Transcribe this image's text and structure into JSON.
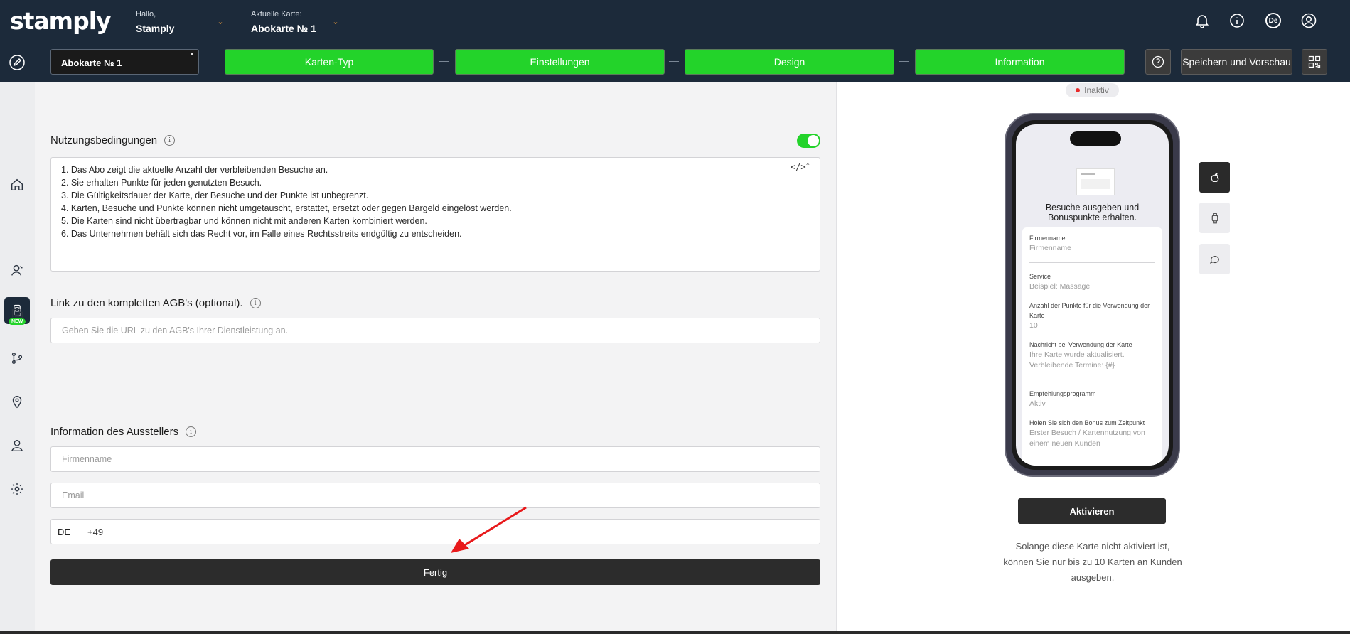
{
  "header": {
    "logo": "stamply",
    "greeting_label": "Hallo,",
    "user_name": "Stamply",
    "current_card_label": "Aktuelle Karte:",
    "current_card_name": "Abokarte № 1",
    "language": "De"
  },
  "toolbar": {
    "card_name": "Abokarte № 1",
    "required_mark": "*",
    "steps": [
      "Karten-Typ",
      "Einstellungen",
      "Design",
      "Information"
    ],
    "save_label": "Speichern und Vorschau"
  },
  "colors": {
    "header_bg": "#1c2a3a",
    "step_green": "#23d32a",
    "dark_button": "#2c2c2c",
    "inactive_dot": "#e82a2a"
  },
  "sidebar": {
    "items": [
      "home-icon",
      "card-icon",
      "customers-icon",
      "chat-icon",
      "flow-icon",
      "location-icon",
      "user-icon",
      "settings-icon"
    ],
    "new_badge": "NEW"
  },
  "form": {
    "terms_title": "Nutzungsbedingungen",
    "terms_enabled": true,
    "terms_lines": [
      "1. Das Abo zeigt die aktuelle Anzahl der verbleibenden Besuche an.",
      "2. Sie erhalten Punkte für jeden genutzten Besuch.",
      "3. Die Gültigkeitsdauer der Karte, der Besuche und der Punkte ist unbegrenzt.",
      "4. Karten, Besuche und Punkte können nicht umgetauscht, erstattet, ersetzt oder gegen Bargeld eingelöst werden.",
      "5. Die Karten sind nicht übertragbar und können nicht mit anderen Karten kombiniert werden.",
      "6. Das Unternehmen behält sich das Recht vor, im Falle eines Rechtsstreits endgültig zu entscheiden."
    ],
    "code_icon": "</>",
    "agb_title": "Link zu den kompletten AGB's (optional).",
    "agb_placeholder": "Geben Sie die URL zu den AGB's Ihrer Dienstleistung an.",
    "issuer_title": "Information des Ausstellers",
    "company_placeholder": "Firmenname",
    "email_placeholder": "Email",
    "phone_country": "DE",
    "phone_value": "+49",
    "done_label": "Fertig"
  },
  "preview": {
    "status": "Inaktiv",
    "screen_title_line1": "Besuche ausgeben und",
    "screen_title_line2": "Bonuspunkte erhalten.",
    "fields": [
      {
        "label": "Firmenname",
        "value": "Firmenname"
      },
      {
        "label": "Service",
        "value": "Beispiel: Massage"
      },
      {
        "label": "Anzahl der Punkte für die Verwendung der Karte",
        "value": "10"
      },
      {
        "label": "Nachricht bei Verwendung der Karte",
        "value": "Ihre Karte wurde aktualisiert. Verbleibende Termine: {#}"
      },
      {
        "label": "Empfehlungsprogramm",
        "value": "Aktiv"
      },
      {
        "label": "Holen Sie sich den Bonus zum Zeitpunkt",
        "value": "Erster Besuch / Kartennutzung von einem neuen Kunden"
      }
    ],
    "activate_label": "Aktivieren",
    "note_line1": "Solange diese Karte nicht aktiviert ist,",
    "note_line2": "können Sie nur bis zu 10 Karten an Kunden",
    "note_line3": "ausgeben."
  }
}
